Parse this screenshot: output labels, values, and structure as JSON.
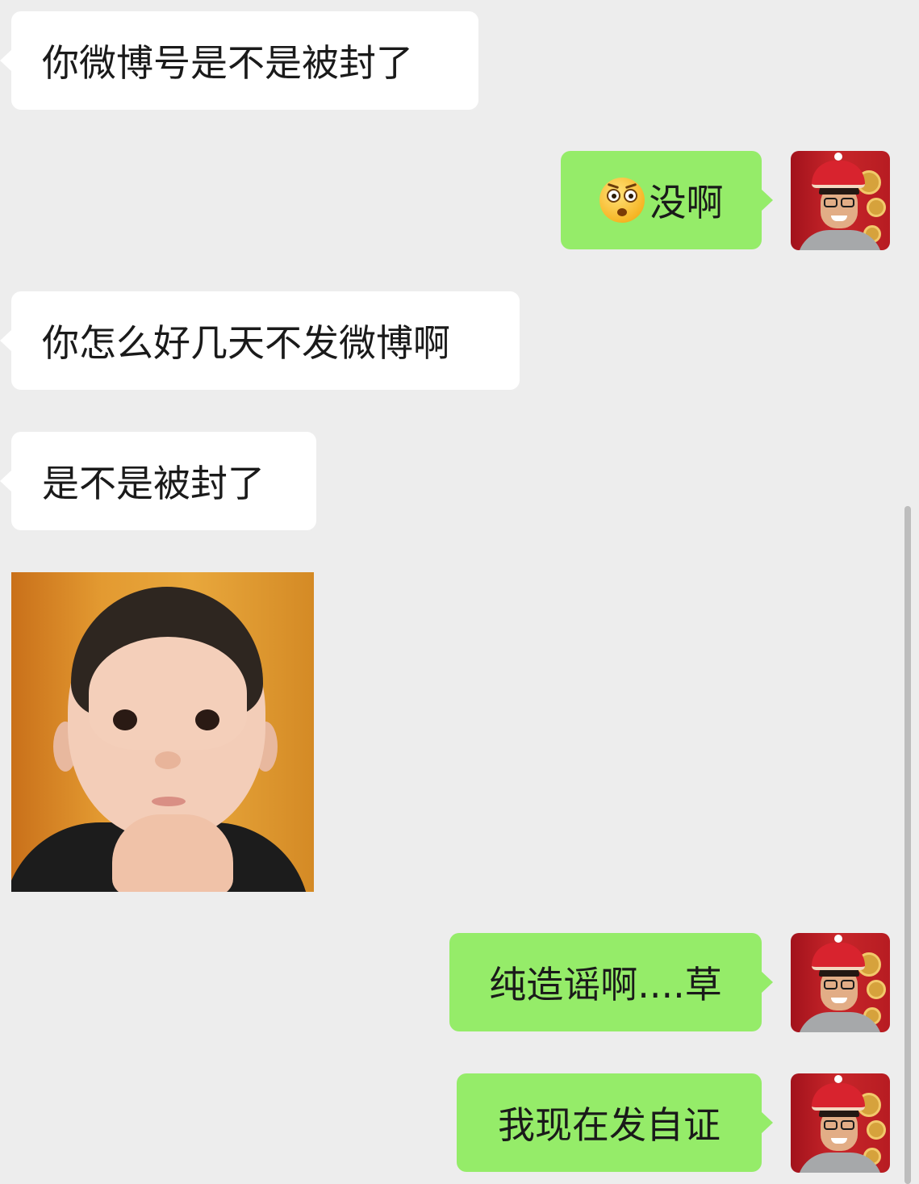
{
  "conversation": {
    "messages": [
      {
        "side": "incoming",
        "type": "text",
        "text": "你微博号是不是被封了"
      },
      {
        "side": "outgoing",
        "type": "text",
        "emoji": "flushed-face",
        "text": "没啊"
      },
      {
        "side": "incoming",
        "type": "text",
        "text": "你怎么好几天不发微博啊"
      },
      {
        "side": "incoming",
        "type": "text",
        "text": "是不是被封了"
      },
      {
        "side": "incoming",
        "type": "image",
        "image": "toddler-chin-on-hand-sticker"
      },
      {
        "side": "outgoing",
        "type": "text",
        "text": "纯造谣啊....草"
      },
      {
        "side": "outgoing",
        "type": "text",
        "text": "我现在发自证"
      }
    ]
  },
  "colors": {
    "background": "#ededed",
    "incoming_bubble": "#ffffff",
    "outgoing_bubble": "#95ec69",
    "text": "#1a1a1a"
  }
}
